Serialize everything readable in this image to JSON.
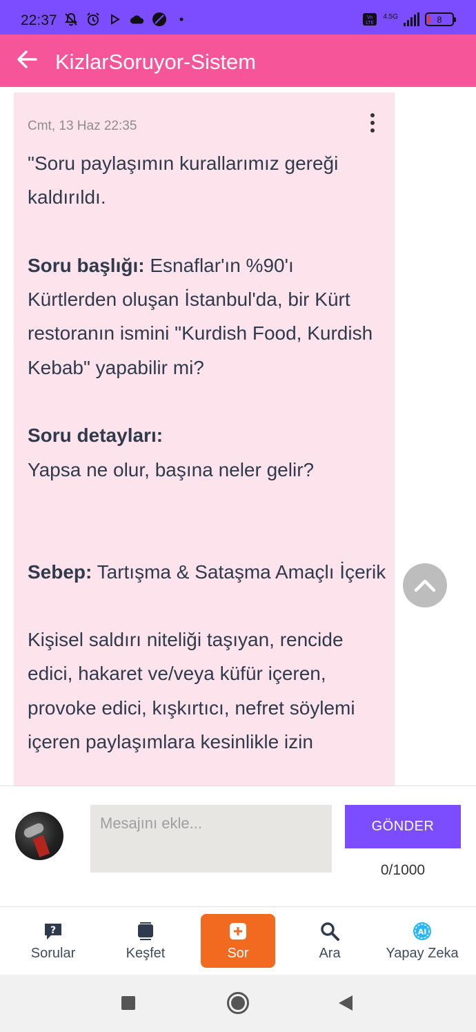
{
  "status_bar": {
    "time": "22:37",
    "network": "4.5G",
    "battery": "8"
  },
  "app_bar": {
    "title": "KizlarSoruyor-Sistem"
  },
  "message": {
    "date": "Cmt, 13 Haz 22:35",
    "intro": "\"Soru paylaşımın kurallarımız gereği kaldırıldı.",
    "title_label": "Soru başlığı:",
    "title_text": " Esnaflar'ın %90'ı Kürtlerden oluşan İstanbul'da, bir Kürt restoranın ismini \"Kurdish Food, Kurdish Kebab\" yapabilir mi?",
    "details_label": "Soru detayları:",
    "details_text": "Yapsa ne olur, başına neler gelir?",
    "reason_label": "Sebep:",
    "reason_text": " Tartışma & Sataşma Amaçlı İçerik",
    "rule_text": "Kişisel saldırı niteliği taşıyan, rencide edici, hakaret ve/veya küfür içeren, provoke edici, kışkırtıcı, nefret söylemi içeren paylaşımlara kesinlikle izin"
  },
  "composer": {
    "placeholder": "Mesajını ekle...",
    "send_label": "GÖNDER",
    "counter": "0/1000"
  },
  "bottom_nav": {
    "items": [
      {
        "label": "Sorular",
        "icon": "question-bubble-icon"
      },
      {
        "label": "Keşfet",
        "icon": "cards-stack-icon"
      },
      {
        "label": "Sor",
        "icon": "plus-square-icon"
      },
      {
        "label": "Ara",
        "icon": "search-icon"
      },
      {
        "label": "Yapay Zeka",
        "icon": "ai-badge-icon"
      }
    ]
  },
  "colors": {
    "status_bar": "#7c4dff",
    "app_bar": "#f7559a",
    "card": "#fde4ec",
    "send_button": "#7c4dff",
    "nav_active": "#f26a1f"
  }
}
